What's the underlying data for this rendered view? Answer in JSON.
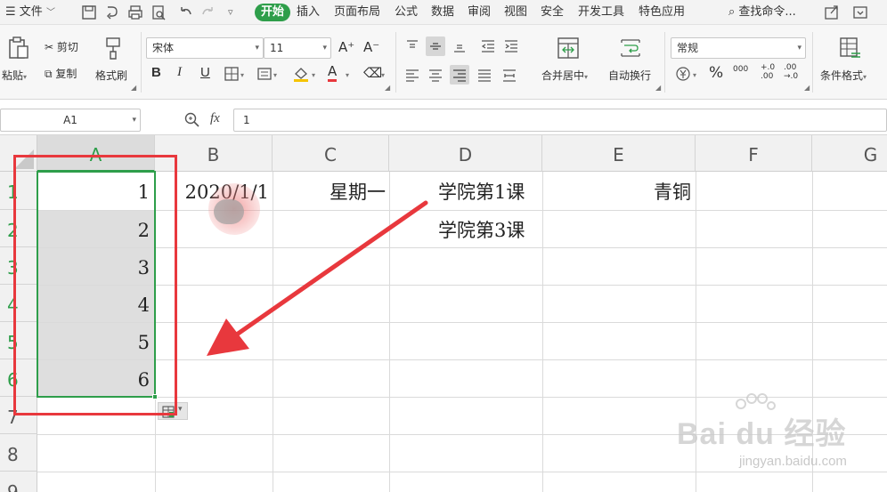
{
  "menubar": {
    "file_label": "文件",
    "tabs": [
      "开始",
      "插入",
      "页面布局",
      "公式",
      "数据",
      "审阅",
      "视图",
      "安全",
      "开发工具",
      "特色应用"
    ],
    "search_label": "查找命令..."
  },
  "ribbon": {
    "paste_label": "粘贴",
    "cut_label": "剪切",
    "copy_label": "复制",
    "format_painter_label": "格式刷",
    "font_name": "宋体",
    "font_size": "11",
    "merge_label": "合并居中",
    "wrap_label": "自动换行",
    "number_format": "常规",
    "conditional_format_label": "条件格式",
    "bold_glyph": "B",
    "italic_glyph": "I",
    "underline_glyph": "U",
    "increase_font_glyph": "A⁺",
    "decrease_font_glyph": "A⁻",
    "font_color_glyph": "A",
    "percent_glyph": "%",
    "thousands_glyph": "000",
    "inc_decimal_glyph": "+.0\n.00",
    "dec_decimal_glyph": ".00\n→.0",
    "accent_color": "#2e9e4a"
  },
  "formula_bar": {
    "name_box": "A1",
    "fx_label": "fx",
    "value": "1"
  },
  "sheet": {
    "columns": [
      "A",
      "B",
      "C",
      "D",
      "E",
      "F",
      "G"
    ],
    "rows": [
      "1",
      "2",
      "3",
      "4",
      "5",
      "6",
      "7",
      "8",
      "9"
    ],
    "cells": {
      "A1": "1",
      "A2": "2",
      "A3": "3",
      "A4": "4",
      "A5": "5",
      "A6": "6",
      "B1": "2020/1/1",
      "C1": "星期一",
      "D1": "学院第1课",
      "D2": "学院第3课",
      "E1": "青铜"
    },
    "selection": "A1:A6"
  },
  "annotation": {
    "box_color": "#e8383d",
    "arrow_color": "#e8383d"
  },
  "watermark": {
    "brand": "Bai du 经验",
    "url": "jingyan.baidu.com"
  }
}
